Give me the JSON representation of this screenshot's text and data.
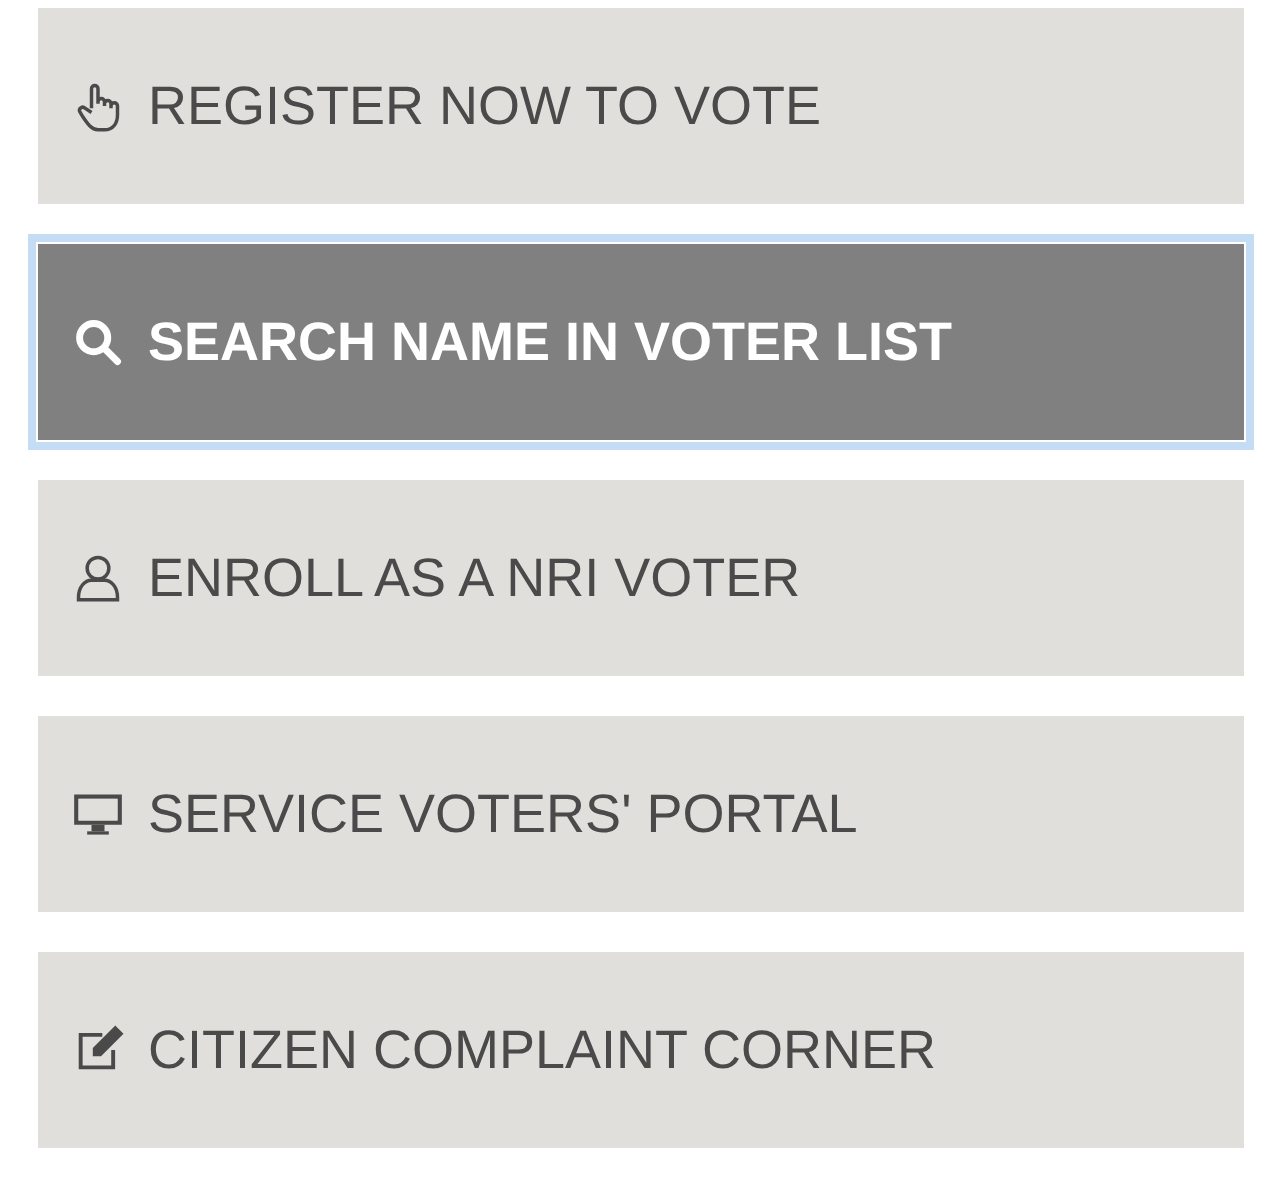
{
  "menu": [
    {
      "label": "REGISTER NOW TO VOTE",
      "kind": "hand",
      "selected": false
    },
    {
      "label": "SEARCH NAME IN VOTER LIST",
      "kind": "search",
      "selected": true
    },
    {
      "label": "ENROLL AS A NRI VOTER",
      "kind": "user",
      "selected": false
    },
    {
      "label": "SERVICE VOTERS' PORTAL",
      "kind": "monitor",
      "selected": false
    },
    {
      "label": "CITIZEN COMPLAINT CORNER",
      "kind": "edit",
      "selected": false
    }
  ]
}
